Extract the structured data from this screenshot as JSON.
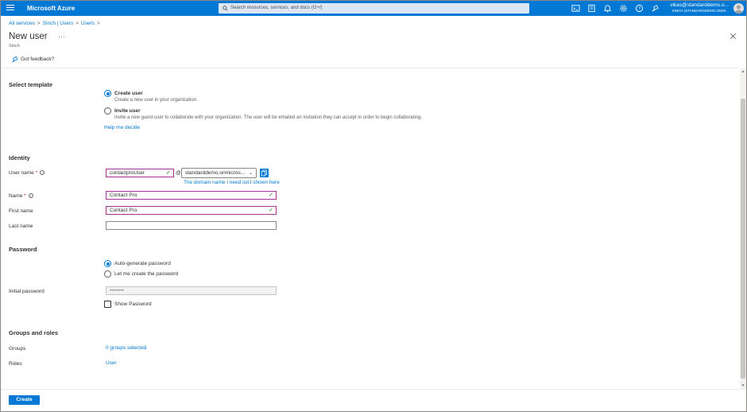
{
  "topbar": {
    "brand": "Microsoft Azure",
    "search_placeholder": "Search resources, services, and docs (G+/)",
    "icons": [
      "cloud-shell-icon",
      "directory-filter-icon",
      "notifications-icon",
      "settings-icon",
      "help-icon",
      "feedback-icon"
    ],
    "account_email": "vikas@standarddemo.o...",
    "account_tenant": "SINCH (STANDARDDEMO.ONMI..."
  },
  "breadcrumb": [
    "All services",
    "Sinch | Users",
    "Users"
  ],
  "header": {
    "title": "New user",
    "subtitle": "Sinch",
    "feedback": "Got feedback?"
  },
  "template": {
    "heading": "Select template",
    "create_title": "Create user",
    "create_desc": "Create a new user in your organization.",
    "invite_title": "Invite user",
    "invite_desc": "Invite a new guest user to collaborate with your organization. The user will be emailed an invitation they can accept in order to begin collaborating.",
    "help_link": "Help me decide",
    "selected": "create"
  },
  "identity": {
    "heading": "Identity",
    "username_label": "User name",
    "username_value": "contactproUser",
    "at": "@",
    "domain_value": "standarddemo.onmicros...",
    "domain_link": "The domain name I need isn't shown here",
    "name_label": "Name",
    "name_value": "Contact Pro",
    "firstname_label": "First name",
    "firstname_value": "Contact Pro",
    "lastname_label": "Last name",
    "lastname_value": ""
  },
  "password": {
    "heading": "Password",
    "auto_label": "Auto-generate password",
    "manual_label": "Let me create the password",
    "selected": "auto",
    "initial_label": "Initial password",
    "initial_value": "••••••••",
    "show_label": "Show Password"
  },
  "groups": {
    "heading": "Groups and roles",
    "groups_label": "Groups",
    "groups_value": "0 groups selected",
    "roles_label": "Roles",
    "roles_value": "User"
  },
  "footer": {
    "create_label": "Create"
  },
  "colors": {
    "accent": "#0078d4",
    "valid_border": "#a4338f",
    "check": "#107c10"
  }
}
